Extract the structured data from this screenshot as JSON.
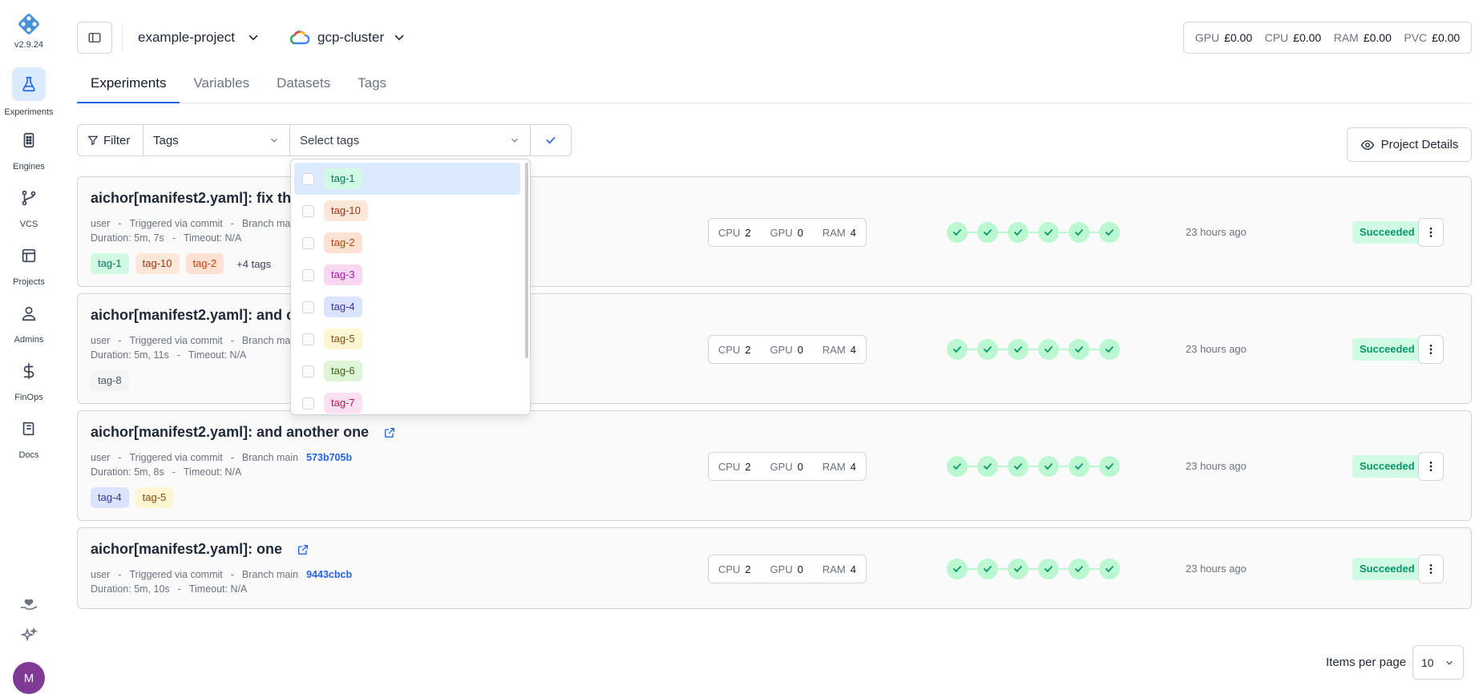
{
  "sidebar": {
    "version": "v2.9.24",
    "items": [
      {
        "label": "Experiments",
        "icon": "flask-icon"
      },
      {
        "label": "Engines",
        "icon": "server-icon"
      },
      {
        "label": "VCS",
        "icon": "git-branch-icon"
      },
      {
        "label": "Projects",
        "icon": "layout-icon"
      },
      {
        "label": "Admins",
        "icon": "user-admin-icon"
      },
      {
        "label": "FinOps",
        "icon": "dollar-icon"
      },
      {
        "label": "Docs",
        "icon": "book-icon"
      }
    ],
    "avatar_initial": "M"
  },
  "header": {
    "project": "example-project",
    "cluster": "gcp-cluster",
    "costs": [
      {
        "k": "GPU",
        "v": "£0.00"
      },
      {
        "k": "CPU",
        "v": "£0.00"
      },
      {
        "k": "RAM",
        "v": "£0.00"
      },
      {
        "k": "PVC",
        "v": "£0.00"
      }
    ]
  },
  "tabs": [
    "Experiments",
    "Variables",
    "Datasets",
    "Tags"
  ],
  "filter": {
    "filter_label": "Filter",
    "field": "Tags",
    "placeholder": "Select tags",
    "details_label": "Project Details"
  },
  "dropdown": {
    "options": [
      {
        "label": "tag-1",
        "bg": "#d1fae5",
        "fg": "#047857"
      },
      {
        "label": "tag-10",
        "bg": "#fde7d8",
        "fg": "#9a3412"
      },
      {
        "label": "tag-2",
        "bg": "#fde2d4",
        "fg": "#c2410c"
      },
      {
        "label": "tag-3",
        "bg": "#f8d7f0",
        "fg": "#a21caf"
      },
      {
        "label": "tag-4",
        "bg": "#dbe4ff",
        "fg": "#3730a3"
      },
      {
        "label": "tag-5",
        "bg": "#fef6d3",
        "fg": "#854d0e"
      },
      {
        "label": "tag-6",
        "bg": "#e0f5d6",
        "fg": "#3f6212"
      },
      {
        "label": "tag-7",
        "bg": "#fbe0f2",
        "fg": "#be185d"
      }
    ]
  },
  "experiments": [
    {
      "title": "aichor[manifest2.yaml]: fix th",
      "user": "user",
      "trigger": "Triggered via commit",
      "branch": "Branch main",
      "commit": "",
      "duration": "Duration: 5m, 7s",
      "timeout": "Timeout: N/A",
      "tags": [
        {
          "label": "tag-1",
          "bg": "#d1fae5",
          "fg": "#047857"
        },
        {
          "label": "tag-10",
          "bg": "#fde7d8",
          "fg": "#9a3412"
        },
        {
          "label": "tag-2",
          "bg": "#fde2d4",
          "fg": "#c2410c"
        }
      ],
      "more_tags": "+4 tags",
      "cpu": "2",
      "gpu": "0",
      "ram": "4",
      "time_ago": "23 hours ago",
      "status": "Succeeded",
      "external": false
    },
    {
      "title": "aichor[manifest2.yaml]: and c",
      "user": "user",
      "trigger": "Triggered via commit",
      "branch": "Branch mai",
      "commit": "",
      "duration": "Duration: 5m, 11s",
      "timeout": "Timeout: N/A",
      "tags": [
        {
          "label": "tag-8",
          "bg": "#f3f4f6",
          "fg": "#4b5563"
        }
      ],
      "more_tags": "",
      "cpu": "2",
      "gpu": "0",
      "ram": "4",
      "time_ago": "23 hours ago",
      "status": "Succeeded",
      "external": false
    },
    {
      "title": "aichor[manifest2.yaml]: and another one",
      "user": "user",
      "trigger": "Triggered via commit",
      "branch": "Branch main",
      "commit": "573b705b",
      "duration": "Duration: 5m, 8s",
      "timeout": "Timeout: N/A",
      "tags": [
        {
          "label": "tag-4",
          "bg": "#dbe4ff",
          "fg": "#3730a3"
        },
        {
          "label": "tag-5",
          "bg": "#fef6d3",
          "fg": "#854d0e"
        }
      ],
      "more_tags": "",
      "cpu": "2",
      "gpu": "0",
      "ram": "4",
      "time_ago": "23 hours ago",
      "status": "Succeeded",
      "external": true
    },
    {
      "title": "aichor[manifest2.yaml]: one",
      "user": "user",
      "trigger": "Triggered via commit",
      "branch": "Branch main",
      "commit": "9443cbcb",
      "duration": "Duration: 5m, 10s",
      "timeout": "Timeout: N/A",
      "tags": [],
      "more_tags": "",
      "cpu": "2",
      "gpu": "0",
      "ram": "4",
      "time_ago": "23 hours ago",
      "status": "Succeeded",
      "external": true
    }
  ],
  "pagination": {
    "label": "Items per page",
    "value": "10"
  },
  "colors": {
    "accent": "#2563eb",
    "success_bg": "#d1fae5",
    "success_fg": "#059669",
    "step": "#bbf7d0"
  }
}
